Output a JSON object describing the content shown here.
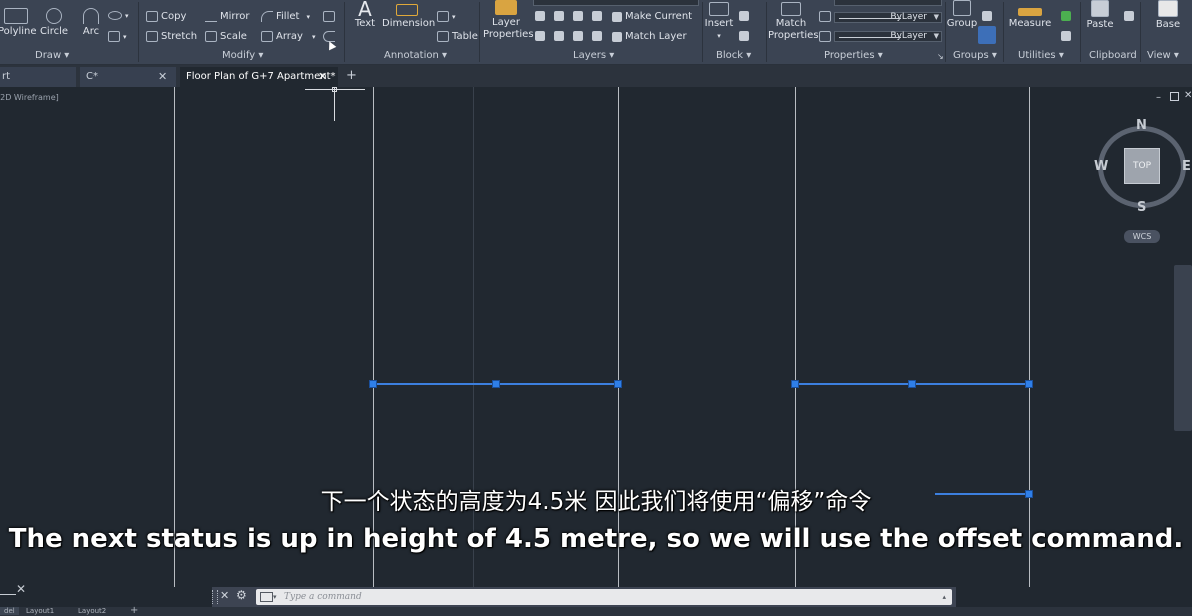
{
  "ribbon": {
    "draw": {
      "polyline": "Polyline",
      "circle": "Circle",
      "arc": "Arc",
      "label": "Draw"
    },
    "modify": {
      "copy": "Copy",
      "mirror": "Mirror",
      "fillet": "Fillet",
      "stretch": "Stretch",
      "scale": "Scale",
      "array": "Array",
      "label": "Modify"
    },
    "annotation": {
      "text": "Text",
      "dimension": "Dimension",
      "table": "Table",
      "label": "Annotation"
    },
    "layers": {
      "layer_properties_line1": "Layer",
      "layer_properties_line2": "Properties",
      "make_current": "Make Current",
      "match_layer": "Match Layer",
      "label": "Layers"
    },
    "block": {
      "insert": "Insert",
      "label": "Block"
    },
    "properties": {
      "match_line1": "Match",
      "match_line2": "Properties",
      "bylayer_1": "ByLayer",
      "bylayer_2": "ByLayer",
      "label": "Properties"
    },
    "groups": {
      "group": "Group",
      "label": "Groups"
    },
    "utilities": {
      "measure": "Measure",
      "label": "Utilities"
    },
    "clipboard": {
      "paste": "Paste",
      "label": "Clipboard"
    },
    "view": {
      "base": "Base",
      "label": "View"
    }
  },
  "tabs": [
    {
      "label": "rt"
    },
    {
      "label": "C*"
    },
    {
      "label": "Floor Plan of G+7 Apartment*"
    }
  ],
  "viewport": {
    "label": "[2D Wireframe]"
  },
  "viewcube": {
    "north": "N",
    "south": "S",
    "east": "E",
    "west": "W",
    "top": "TOP",
    "wcs": "WCS"
  },
  "command": {
    "placeholder": "Type a command"
  },
  "layout_tabs": [
    "del",
    "Layout1",
    "Layout2"
  ],
  "subtitles": {
    "zh": "下一个状态的高度为4.5米 因此我们将使用“偏移”命令",
    "en": "The next status is up in height of 4.5 metre, so we will use the offset command."
  },
  "colors": {
    "selection": "#3c7fde",
    "canvas": "#212830",
    "ribbon": "#3b4453"
  }
}
